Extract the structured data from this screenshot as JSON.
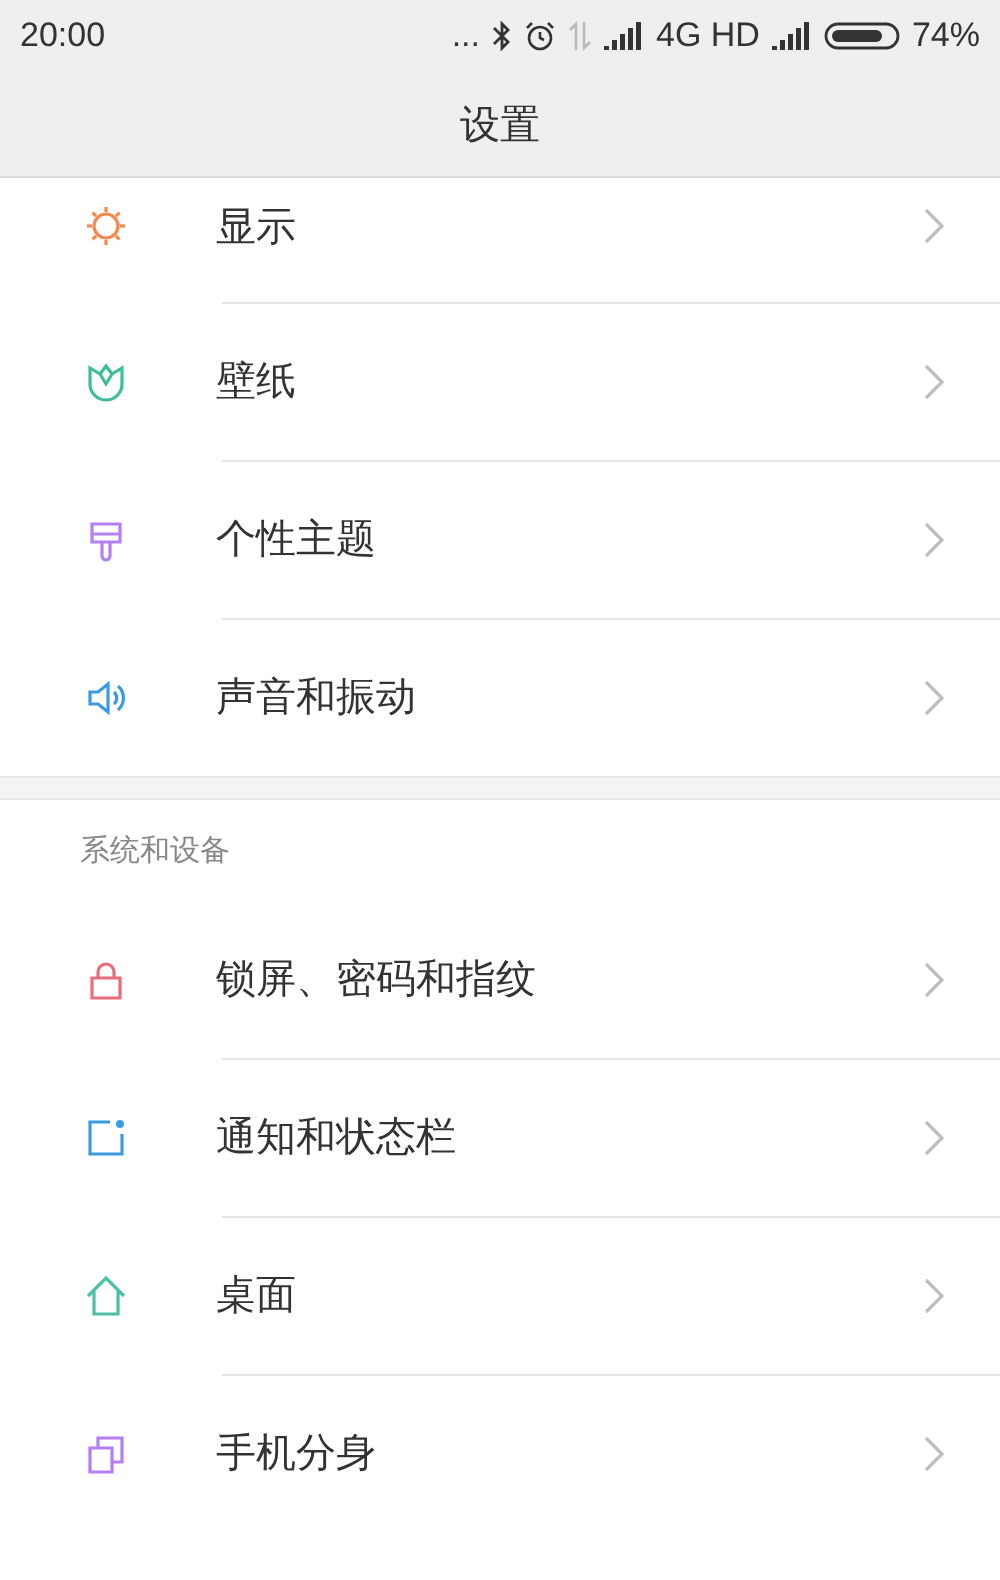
{
  "status_bar": {
    "time": "20:00",
    "more": "...",
    "network": "4G HD",
    "battery": "74%"
  },
  "header": {
    "title": "设置"
  },
  "sections": [
    {
      "items": [
        {
          "label": "显示",
          "kind": "sun",
          "color": "#f5874f",
          "chevron": true
        },
        {
          "label": "壁纸",
          "kind": "tulip",
          "color": "#3dbd9b",
          "chevron": true
        },
        {
          "label": "个性主题",
          "kind": "brush",
          "color": "#b37ff5",
          "chevron": true
        },
        {
          "label": "声音和振动",
          "kind": "speaker",
          "color": "#3a9be0",
          "chevron": true
        }
      ]
    },
    {
      "title": "系统和设备",
      "items": [
        {
          "label": "锁屏、密码和指纹",
          "kind": "lock",
          "color": "#ea6b7b",
          "chevron": true
        },
        {
          "label": "通知和状态栏",
          "kind": "notice",
          "color": "#3a9be0",
          "chevron": true
        },
        {
          "label": "桌面",
          "kind": "home",
          "color": "#4dbfa5",
          "chevron": true
        },
        {
          "label": "手机分身",
          "kind": "copy",
          "color": "#b37ff5",
          "chevron": true
        }
      ]
    }
  ]
}
